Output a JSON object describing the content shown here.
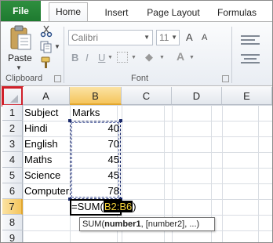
{
  "ribbon_tabs": {
    "file": "File",
    "home": "Home",
    "insert": "Insert",
    "page_layout": "Page Layout",
    "formulas": "Formulas"
  },
  "clipboard": {
    "paste_label": "Paste",
    "group_label": "Clipboard",
    "paste_icon": "clipboard-paste-icon",
    "cut_icon": "scissors-icon",
    "copy_icon": "copy-icon",
    "format_painter_icon": "paintbrush-icon"
  },
  "font": {
    "name": "Calibri",
    "size": "11",
    "group_label": "Font",
    "bold": "B",
    "italic": "I",
    "underline": "U",
    "grow": "A",
    "shrink": "A",
    "font_color": "A"
  },
  "columns": [
    "A",
    "B",
    "C",
    "D",
    "E"
  ],
  "rows": [
    "1",
    "2",
    "3",
    "4",
    "5",
    "6",
    "7",
    "8",
    "9"
  ],
  "cells": {
    "A1": "Subject",
    "B1": "Marks",
    "A2": "Hindi",
    "B2": "40",
    "A3": "English",
    "B3": "70",
    "A4": "Maths",
    "B4": "45",
    "A5": "Science",
    "B5": "45",
    "A6": "Computer",
    "B6": "78"
  },
  "active_cell": {
    "formula_prefix": "=SUM(",
    "range_ref": "B2:B6",
    "formula_suffix": ")"
  },
  "tooltip": {
    "prefix": "SUM(",
    "bold_arg": "number1",
    "rest": ", [number2], ...)"
  },
  "colors": {
    "file_tab": "#1e7a30",
    "selection_header": "#f5c55c",
    "corner_highlight": "#d0202a",
    "range_ref_bg": "#000000",
    "range_ref_text": "#f4d23a"
  }
}
